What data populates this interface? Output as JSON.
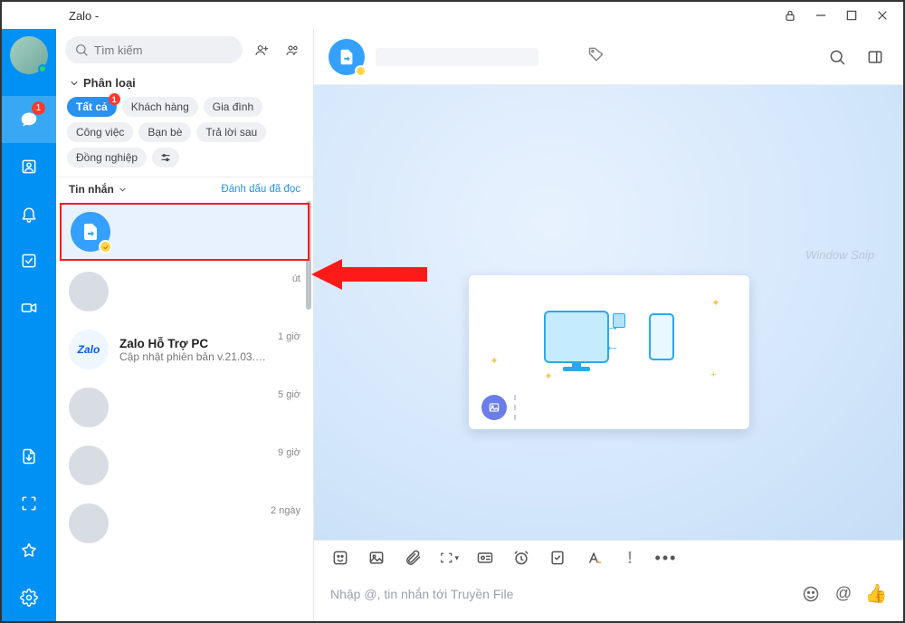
{
  "window": {
    "title": "Zalo -"
  },
  "rail": {
    "chat_badge": "1"
  },
  "search": {
    "placeholder": "Tìm kiếm"
  },
  "categories": {
    "title": "Phân loại",
    "chips": [
      {
        "label": "Tất cả",
        "active": true,
        "badge": "1"
      },
      {
        "label": "Khách hàng"
      },
      {
        "label": "Gia đình"
      },
      {
        "label": "Công việc"
      },
      {
        "label": "Bạn bè"
      },
      {
        "label": "Trả lời sau"
      },
      {
        "label": "Đồng nghiệp"
      }
    ]
  },
  "filter_bar": {
    "label": "Tin nhắn",
    "mark_read": "Đánh dấu đã đọc"
  },
  "conversations": [
    {
      "type": "file",
      "name": "",
      "preview": "",
      "time": ""
    },
    {
      "type": "blur",
      "name": "",
      "preview": "",
      "time": "út"
    },
    {
      "type": "zalo",
      "name": "Zalo Hỗ Trợ PC",
      "preview": "Cập nhật phiên bản v.21.03.03…",
      "time": "1 giờ"
    },
    {
      "type": "blur",
      "name": "",
      "preview": "",
      "time": "5 giờ"
    },
    {
      "type": "blur",
      "name": "",
      "preview": "",
      "time": "9 giờ"
    },
    {
      "type": "blur",
      "name": "",
      "preview": "",
      "time": "2 ngày"
    }
  ],
  "chat": {
    "compose_placeholder": "Nhập @, tin nhắn tới Truyền File",
    "watermark": "Window Snip"
  }
}
